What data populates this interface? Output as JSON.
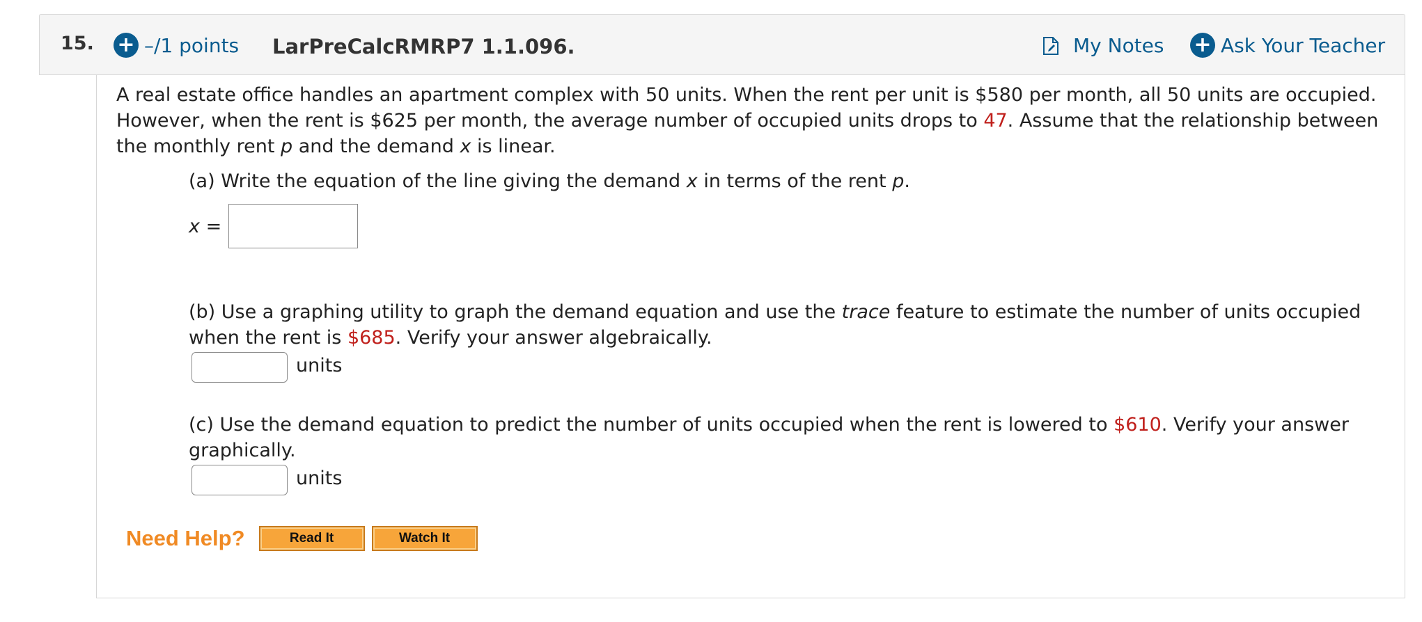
{
  "header": {
    "question_number": "15.",
    "points": "–/1 points",
    "assignment_id": "LarPreCalcRMRP7 1.1.096.",
    "my_notes_label": "My Notes",
    "ask_teacher_label": "Ask Your Teacher"
  },
  "problem": {
    "intro_1": "A real estate office handles an apartment complex with 50 units. When the rent per unit is $580 per month, all 50 units are occupied. However, when the rent is $625 per month, the average number of occupied units drops to ",
    "intro_red": "47",
    "intro_2": ". Assume that the relationship between the monthly rent ",
    "intro_var_p": "p",
    "intro_3": " and the demand ",
    "intro_var_x": "x",
    "intro_4": " is linear."
  },
  "part_a": {
    "text_1": "(a) Write the equation of the line giving the demand ",
    "var_x": "x",
    "text_2": " in terms of the rent ",
    "var_p": "p",
    "text_3": ".",
    "answer_label_var": "x",
    "answer_label_eq": " =",
    "answer_value": ""
  },
  "part_b": {
    "text_1": "(b) Use a graphing utility to graph the demand equation and use the ",
    "italic": "trace",
    "text_2": " feature to estimate the number of units occupied when the rent is ",
    "red": "$685",
    "text_3": ". Verify your answer algebraically.",
    "unit_label": "units",
    "answer_value": ""
  },
  "part_c": {
    "text_1": "(c) Use the demand equation to predict the number of units occupied when the rent is lowered to ",
    "red": "$610",
    "text_2": ". Verify your answer graphically.",
    "unit_label": "units",
    "answer_value": ""
  },
  "help": {
    "label": "Need Help?",
    "read_button": "Read It",
    "watch_button": "Watch It"
  },
  "icons": {
    "points": "plus-circle-icon",
    "notes": "document-icon",
    "ask_teacher": "plus-circle-icon"
  },
  "colors": {
    "link": "#0a5c8f",
    "highlight": "#c0201c",
    "help": "#f08a24",
    "help_button": "#f7a53a"
  }
}
